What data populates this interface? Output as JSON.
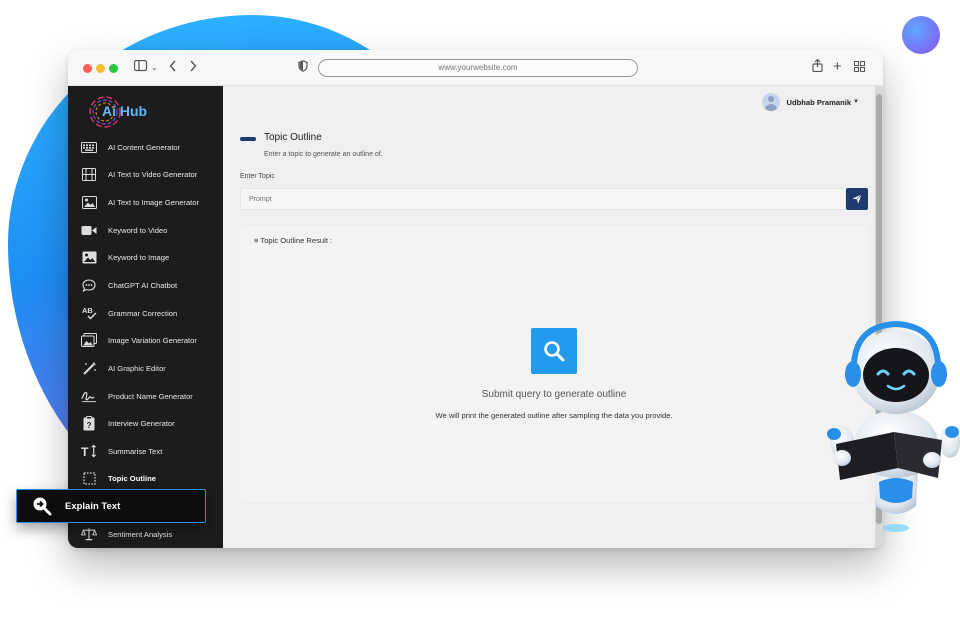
{
  "browser": {
    "url": "www.yourwebsite.com"
  },
  "brand": {
    "name": "Ai Hub"
  },
  "sidebar": {
    "items": [
      {
        "label": "AI Content Generator",
        "icon": "keyboard-icon"
      },
      {
        "label": "AI Text to Video Generator",
        "icon": "film-icon"
      },
      {
        "label": "AI Text to Image Generator",
        "icon": "image-icon"
      },
      {
        "label": "Keyword to Video",
        "icon": "video-camera-icon"
      },
      {
        "label": "Keyword to Image",
        "icon": "picture-icon"
      },
      {
        "label": "ChatGPT AI Chatbot",
        "icon": "chat-bubble-icon"
      },
      {
        "label": "Grammar Correction",
        "icon": "spellcheck-icon"
      },
      {
        "label": "Image Variation Generator",
        "icon": "images-icon"
      },
      {
        "label": "AI Graphic Editor",
        "icon": "magic-wand-icon"
      },
      {
        "label": "Product Name Generator",
        "icon": "signature-icon"
      },
      {
        "label": "Interview Generator",
        "icon": "clipboard-question-icon"
      },
      {
        "label": "Summarise Text",
        "icon": "text-height-icon"
      },
      {
        "label": "Topic Outline",
        "icon": "dotted-square-icon"
      },
      {
        "label": "Explain Text",
        "icon": "search-arrow-icon"
      },
      {
        "label": "Sentiment Analysis",
        "icon": "scales-icon"
      }
    ],
    "active": "Topic Outline",
    "highlighted": "Explain Text"
  },
  "header": {
    "user_name": "Udbhab Pramanik"
  },
  "page": {
    "title": "Topic Outline",
    "subtitle": "Enter a topic to generate an outline of.",
    "field_label": "Enter Topic",
    "placeholder": "Prompt",
    "result_title": "≡ Topic Outline Result :",
    "empty_title": "Submit query to generate outline",
    "empty_subtitle": "We will print the generated outline after sampling the data you provide."
  },
  "colors": {
    "accent": "#1f3a6e",
    "search_box": "#229bec",
    "sidebar_bg": "#1c1c1c",
    "highlight_border": "#2b8be8"
  }
}
